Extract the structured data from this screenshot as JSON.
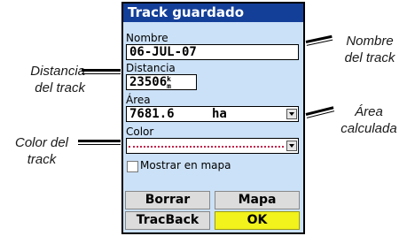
{
  "window": {
    "title": "Track guardado"
  },
  "fields": {
    "name": {
      "label": "Nombre",
      "value": "06-JUL-07"
    },
    "distance": {
      "label": "Distancia",
      "value": "23506",
      "unit_top": "k",
      "unit_bottom": "m"
    },
    "area": {
      "label": "Área",
      "value": "7681.6",
      "unit": "ha"
    },
    "color": {
      "label": "Color",
      "value_color": "#c0224a"
    }
  },
  "checkbox": {
    "label": "Mostrar en mapa",
    "checked": false
  },
  "buttons": {
    "delete": "Borrar",
    "map": "Mapa",
    "trackback": "TracBack",
    "ok": "OK"
  },
  "callouts": {
    "track_name": [
      "Nombre",
      "del track"
    ],
    "track_distance": [
      "Distancia",
      "del track"
    ],
    "calc_area": [
      "Área",
      "calculada"
    ],
    "track_color": [
      "Color del",
      "track"
    ]
  },
  "colors": {
    "title_bar": "#143f99",
    "screen": "#cbe1f7",
    "ok_button": "#f2f21c"
  }
}
